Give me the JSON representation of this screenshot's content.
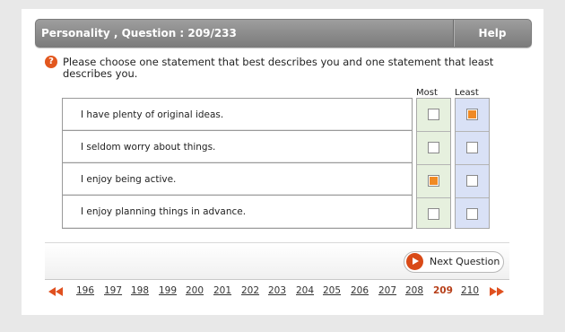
{
  "header": {
    "title": "Personality , Question : 209/233",
    "help_label": "Help"
  },
  "instruction": "Please choose one statement that best describes you and one statement that least describes you.",
  "columns": {
    "most": "Most",
    "least": "Least"
  },
  "statements": [
    {
      "text": "I have plenty of original ideas.",
      "most": false,
      "least": true
    },
    {
      "text": "I seldom worry about things.",
      "most": false,
      "least": false
    },
    {
      "text": "I enjoy being active.",
      "most": true,
      "least": false
    },
    {
      "text": "I enjoy planning things in advance.",
      "most": false,
      "least": false
    }
  ],
  "footer": {
    "next_label": "Next Question"
  },
  "pagination": {
    "pages": [
      "196",
      "197",
      "198",
      "199",
      "200",
      "201",
      "202",
      "203",
      "204",
      "205",
      "206",
      "207",
      "208",
      "209",
      "210"
    ],
    "current": "209"
  },
  "colors": {
    "accent": "#e0501f",
    "checked": "#f08a24",
    "most_bg": "#e6f0de",
    "least_bg": "#d9e1f6"
  }
}
